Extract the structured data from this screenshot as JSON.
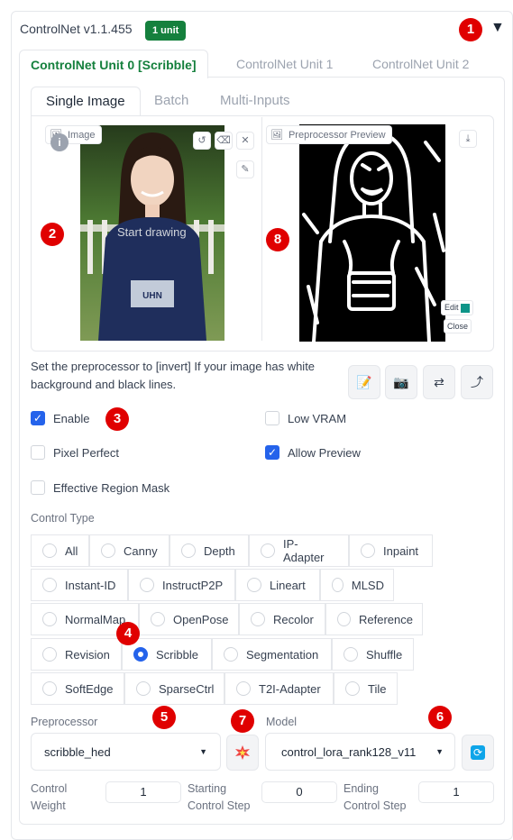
{
  "header": {
    "title": "ControlNet v1.1.455",
    "badge": "1 unit",
    "collapse_icon": "triangle-down-icon"
  },
  "markers": [
    "1",
    "2",
    "3",
    "4",
    "5",
    "6",
    "7",
    "8"
  ],
  "unit_tabs": [
    {
      "label": "ControlNet Unit 0 [Scribble]",
      "active": true
    },
    {
      "label": "ControlNet Unit 1",
      "active": false
    },
    {
      "label": "ControlNet Unit 2",
      "active": false
    }
  ],
  "input_tabs": [
    {
      "label": "Single Image",
      "active": true
    },
    {
      "label": "Batch",
      "active": false
    },
    {
      "label": "Multi-Inputs",
      "active": false
    }
  ],
  "image_panel": {
    "label": "Image",
    "canvas_hint": "Start drawing",
    "preview_label": "Preprocessor Preview",
    "edit_label": "Edit",
    "close_label": "Close"
  },
  "hint_text": "Set the preprocessor to [invert] If your image has white background and black lines.",
  "tool_buttons": [
    "edit-icon",
    "camera-icon",
    "swap-icon",
    "curve-arrow-icon"
  ],
  "checkboxes": {
    "enable": {
      "label": "Enable",
      "checked": true
    },
    "low_vram": {
      "label": "Low VRAM",
      "checked": false
    },
    "pixel_perfect": {
      "label": "Pixel Perfect",
      "checked": false
    },
    "allow_preview": {
      "label": "Allow Preview",
      "checked": true
    },
    "effective_region_mask": {
      "label": "Effective Region Mask",
      "checked": false
    }
  },
  "control_type": {
    "label": "Control Type",
    "options": [
      "All",
      "Canny",
      "Depth",
      "IP-Adapter",
      "Inpaint",
      "Instant-ID",
      "InstructP2P",
      "Lineart",
      "MLSD",
      "NormalMap",
      "OpenPose",
      "Recolor",
      "Reference",
      "Revision",
      "Scribble",
      "Segmentation",
      "Shuffle",
      "SoftEdge",
      "SparseCtrl",
      "T2I-Adapter",
      "Tile"
    ],
    "selected": "Scribble"
  },
  "preprocessor": {
    "label": "Preprocessor",
    "value": "scribble_hed"
  },
  "model": {
    "label": "Model",
    "value": "control_lora_rank128_v11"
  },
  "sliders": {
    "control_weight": {
      "label_line1": "Control",
      "label_line2": "Weight",
      "value": "1"
    },
    "starting_step": {
      "label_line1": "Starting",
      "label_line2": "Control Step",
      "value": "0"
    },
    "ending_step": {
      "label_line1": "Ending",
      "label_line2": "Control Step",
      "value": "1"
    }
  },
  "colors": {
    "accent": "#15803d",
    "checkbox": "#2563eb",
    "marker": "#e00000"
  }
}
